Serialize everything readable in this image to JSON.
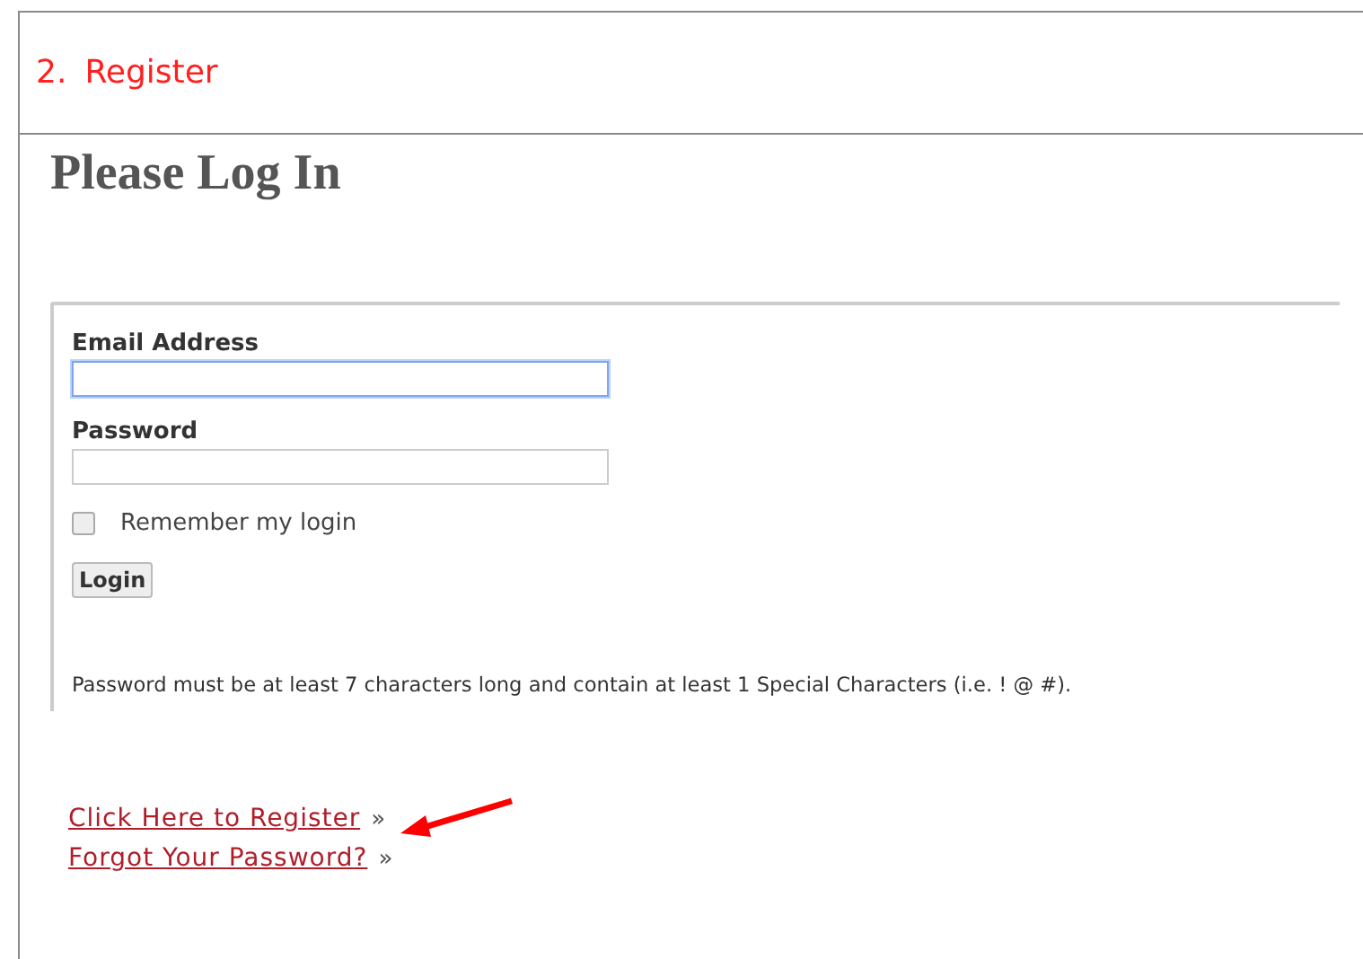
{
  "step": {
    "number": "2.",
    "label": "Register"
  },
  "heading": "Please Log In",
  "form": {
    "fields": [
      {
        "label": "Email Address",
        "focused": true
      },
      {
        "label": "Password",
        "focused": false
      }
    ],
    "remember": {
      "label": "Remember my login",
      "checked": false
    },
    "submit": "Login",
    "note": "Password must be at least 7 characters long and contain at least 1 Special Characters (i.e. ! @ #)."
  },
  "links": [
    {
      "label": "Click Here to Register",
      "suffix": "»",
      "annotated": true
    },
    {
      "label": "Forgot Your Password?",
      "suffix": "»",
      "annotated": false
    }
  ]
}
